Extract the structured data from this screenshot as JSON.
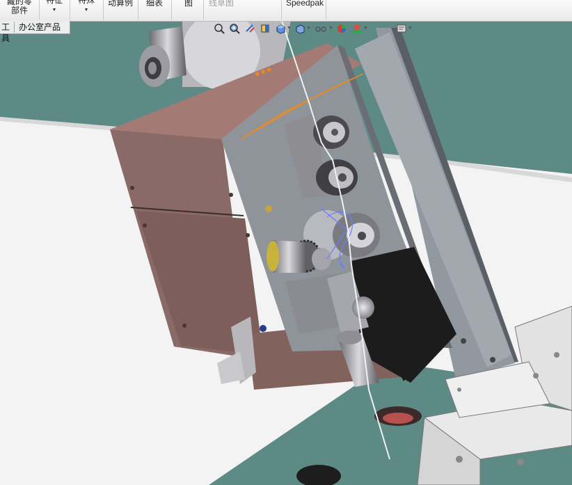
{
  "ribbon": {
    "buttons": [
      {
        "line1": "藏的零",
        "line2": "部件",
        "dropdown": false
      },
      {
        "line1": "特征",
        "line2": "",
        "dropdown": true
      },
      {
        "line1": "特殊",
        "line2": "",
        "dropdown": true
      },
      {
        "line1": "动算例",
        "line2": "",
        "dropdown": false
      },
      {
        "line1": "细表",
        "line2": "",
        "dropdown": false
      },
      {
        "line1": "图",
        "line2": "",
        "dropdown": false
      },
      {
        "line1": "线草图",
        "line2": "",
        "dropdown": false
      },
      {
        "line1": "Speedpak",
        "line2": "",
        "dropdown": false
      }
    ]
  },
  "tabs": [
    "工具",
    "办公室产品"
  ],
  "hud_icons": [
    "zoom-to-fit-icon",
    "zoom-area-icon",
    "previous-view-icon",
    "section-view-icon",
    "view-orientation-icon",
    "display-style-icon",
    "hide-show-items-icon",
    "edit-appearance-icon",
    "apply-scene-icon",
    "view-settings-icon"
  ],
  "colors": {
    "background_top": "#bfbfbf",
    "floor_green": "#5e8a86",
    "housing_brown": "#8a6a66",
    "plate_gray": "#8f949a",
    "motor_black": "#1c1c1c",
    "selection_orange": "#e88a20"
  }
}
